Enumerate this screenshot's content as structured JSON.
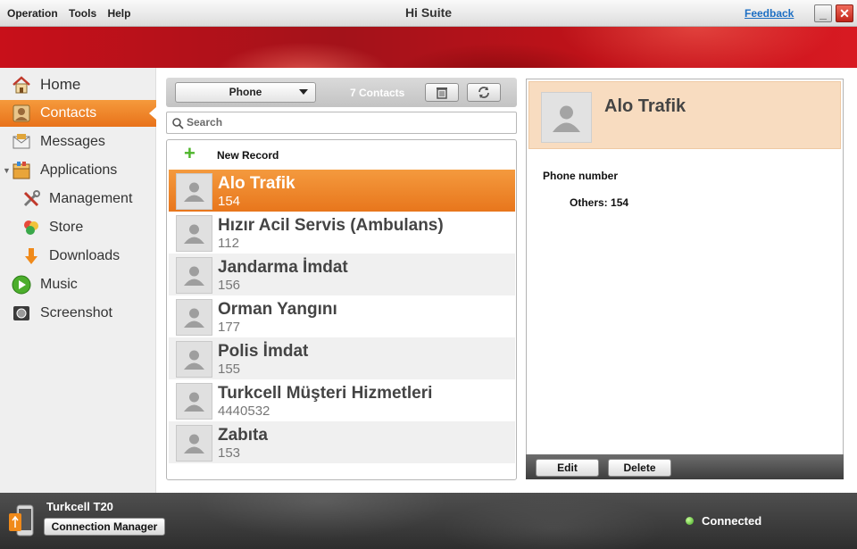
{
  "window": {
    "title": "Hi Suite",
    "menu": [
      "Operation",
      "Tools",
      "Help"
    ],
    "feedback_link": "Feedback",
    "minimize_glyph": "_",
    "close_glyph": "✕"
  },
  "sidebar": {
    "items": [
      {
        "label": "Home",
        "icon": "home-icon",
        "active": false
      },
      {
        "label": "Contacts",
        "icon": "contacts-icon",
        "active": true
      },
      {
        "label": "Messages",
        "icon": "messages-icon",
        "active": false
      },
      {
        "label": "Applications",
        "icon": "applications-icon",
        "active": false,
        "expanded": true
      },
      {
        "label": "Management",
        "icon": "management-icon",
        "active": false,
        "sub": true
      },
      {
        "label": "Store",
        "icon": "store-icon",
        "active": false,
        "sub": true
      },
      {
        "label": "Downloads",
        "icon": "downloads-icon",
        "active": false,
        "sub": true
      },
      {
        "label": "Music",
        "icon": "music-icon",
        "active": false
      },
      {
        "label": "Screenshot",
        "icon": "screenshot-icon",
        "active": false
      }
    ]
  },
  "contacts_toolbar": {
    "source_select": "Phone",
    "count_label": "7 Contacts"
  },
  "search": {
    "placeholder": "Search",
    "value": ""
  },
  "contact_list": {
    "new_record_label": "New Record",
    "rows": [
      {
        "name": "Alo Trafik",
        "number": "154",
        "selected": true
      },
      {
        "name": "Hızır Acil Servis (Ambulans)",
        "number": "112",
        "selected": false
      },
      {
        "name": "Jandarma İmdat",
        "number": "156",
        "selected": false
      },
      {
        "name": "Orman Yangını",
        "number": "177",
        "selected": false
      },
      {
        "name": "Polis İmdat",
        "number": "155",
        "selected": false
      },
      {
        "name": "Turkcell Müşteri Hizmetleri",
        "number": "4440532",
        "selected": false
      },
      {
        "name": "Zabıta",
        "number": "153",
        "selected": false
      }
    ]
  },
  "detail": {
    "name": "Alo Trafik",
    "section_label": "Phone number",
    "field_label": "Others:",
    "field_value": "154",
    "edit_label": "Edit",
    "delete_label": "Delete"
  },
  "status": {
    "device_name": "Turkcell T20",
    "connection_manager_label": "Connection Manager",
    "connection_status": "Connected"
  },
  "colors": {
    "accent": "#e8761c",
    "banner": "#c8101a",
    "status_ok": "#3ea51e"
  }
}
